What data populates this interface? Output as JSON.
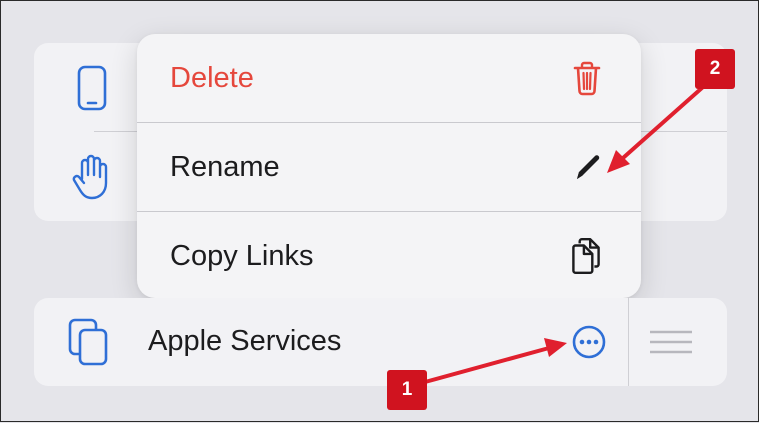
{
  "context_menu": {
    "items": [
      {
        "label": "Delete",
        "icon": "trash-icon",
        "role": "destructive"
      },
      {
        "label": "Rename",
        "icon": "pencil-icon"
      },
      {
        "label": "Copy Links",
        "icon": "copy-documents-icon"
      }
    ]
  },
  "background_list": {
    "icons": [
      "iphone-icon",
      "hand-icon"
    ]
  },
  "list_row": {
    "label": "Apple Services",
    "icon": "stacked-documents-icon",
    "more_icon": "ellipsis-circle-icon",
    "handle_icon": "reorder-handle-icon"
  },
  "annotations": [
    {
      "number": "1"
    },
    {
      "number": "2"
    }
  ],
  "colors": {
    "accent": "#2f6fd6",
    "destructive": "#e5473c",
    "callout": "#d0131f",
    "arrow": "#e0202e"
  }
}
